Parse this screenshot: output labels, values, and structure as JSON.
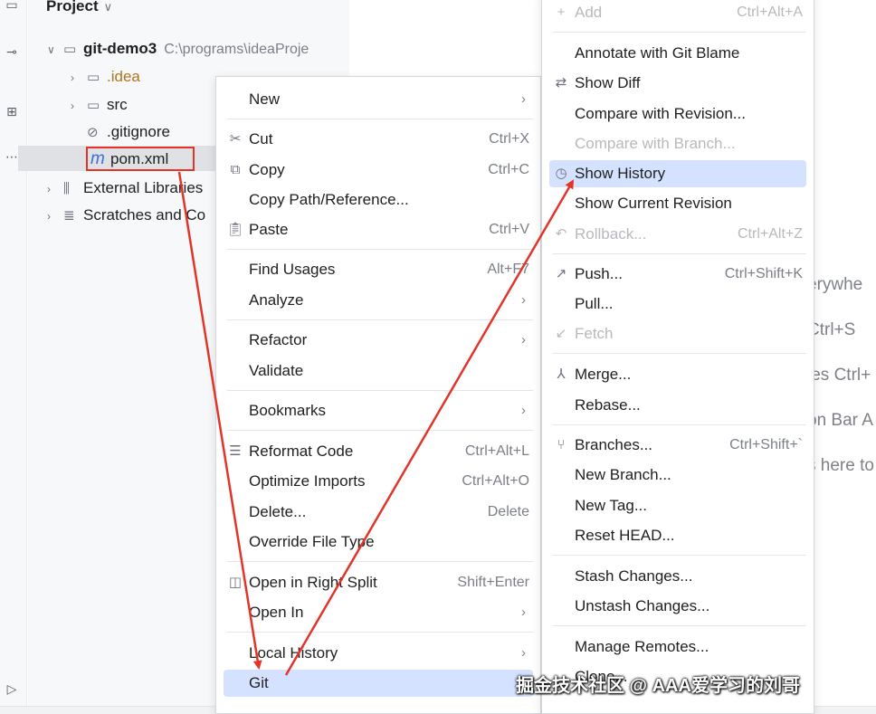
{
  "project_panel": {
    "title": "Project",
    "tree": [
      {
        "name": "git-demo3",
        "path": "C:\\programs\\ideaProje"
      },
      {
        "name": ".idea"
      },
      {
        "name": "src"
      },
      {
        "name": ".gitignore"
      },
      {
        "name": "pom.xml",
        "icon_letter": "m"
      },
      {
        "name": "External Libraries"
      },
      {
        "name": "Scratches and Co"
      }
    ]
  },
  "editor_hints": [
    "erywhe",
    "Ctrl+S",
    "les Ctrl+",
    "on Bar A",
    "s here to"
  ],
  "context_menu": {
    "items": [
      {
        "label": "New",
        "submenu": "›"
      },
      {
        "label": "Cut",
        "shortcut": "Ctrl+X"
      },
      {
        "label": "Copy",
        "shortcut": "Ctrl+C"
      },
      {
        "label": "Copy Path/Reference..."
      },
      {
        "label": "Paste",
        "shortcut": "Ctrl+V"
      },
      {
        "label": "Find Usages",
        "shortcut": "Alt+F7"
      },
      {
        "label": "Analyze",
        "submenu": "›"
      },
      {
        "label": "Refactor",
        "submenu": "›"
      },
      {
        "label": "Validate"
      },
      {
        "label": "Bookmarks",
        "submenu": "›"
      },
      {
        "label": "Reformat Code",
        "shortcut": "Ctrl+Alt+L"
      },
      {
        "label": "Optimize Imports",
        "shortcut": "Ctrl+Alt+O"
      },
      {
        "label": "Delete...",
        "shortcut": "Delete"
      },
      {
        "label": "Override File Type"
      },
      {
        "label": "Open in Right Split",
        "shortcut": "Shift+Enter"
      },
      {
        "label": "Open In",
        "submenu": "›"
      },
      {
        "label": "Local History",
        "submenu": "›"
      },
      {
        "label": "Git"
      }
    ]
  },
  "git_menu": {
    "items": [
      {
        "label": "Add",
        "shortcut": "Ctrl+Alt+A"
      },
      {
        "label": "Annotate with Git Blame"
      },
      {
        "label": "Show Diff"
      },
      {
        "label": "Compare with Revision..."
      },
      {
        "label": "Compare with Branch..."
      },
      {
        "label": "Show History"
      },
      {
        "label": "Show Current Revision"
      },
      {
        "label": "Rollback...",
        "shortcut": "Ctrl+Alt+Z"
      },
      {
        "label": "Push...",
        "shortcut": "Ctrl+Shift+K"
      },
      {
        "label": "Pull..."
      },
      {
        "label": "Fetch"
      },
      {
        "label": "Merge..."
      },
      {
        "label": "Rebase..."
      },
      {
        "label": "Branches...",
        "shortcut": "Ctrl+Shift+`"
      },
      {
        "label": "New Branch..."
      },
      {
        "label": "New Tag..."
      },
      {
        "label": "Reset HEAD..."
      },
      {
        "label": "Stash Changes..."
      },
      {
        "label": "Unstash Changes..."
      },
      {
        "label": "Manage Remotes..."
      },
      {
        "label": "Clone..."
      }
    ]
  },
  "watermark": "掘金技术社区 @ AAA爱学习的刘哥",
  "colors": {
    "highlight": "#d4e2ff",
    "annotation": "#e2352a",
    "pom_icon": "#3b6fd8"
  }
}
